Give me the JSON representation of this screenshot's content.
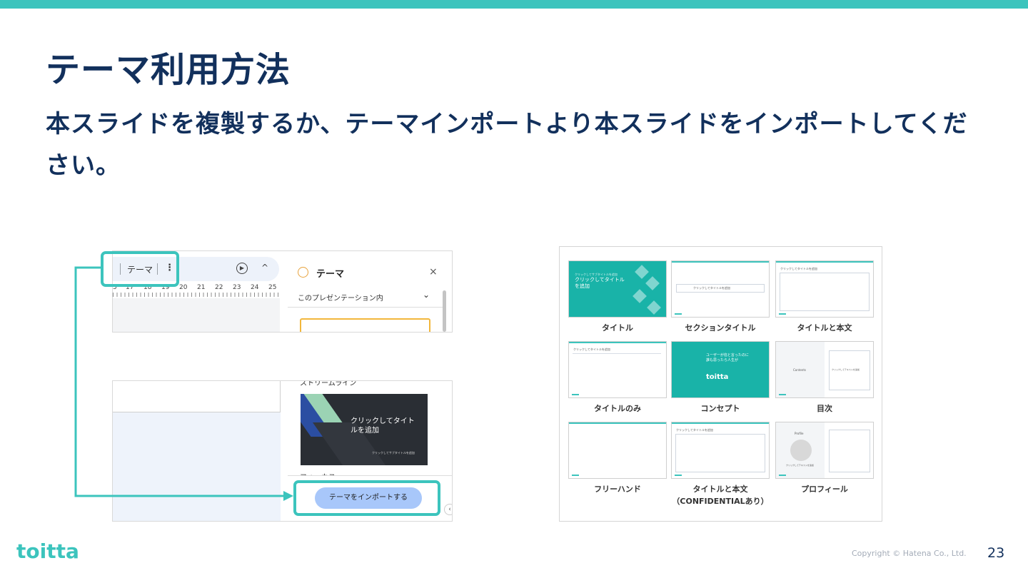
{
  "colors": {
    "accent": "#3cc4bd",
    "title": "#12305c",
    "button": "#a8c7fa",
    "highlight_yellow": "#f2b73c"
  },
  "title": "テーマ利用方法",
  "subtitle": "本スライドを複製するか、テーマインポートより本スライドをインポートしてください。",
  "editor": {
    "toolbar_theme_label": "テーマ",
    "more_icon": "⋮",
    "play_icon": "▶",
    "caret_icon": "^",
    "ruler": [
      "5",
      "17",
      "18",
      "19",
      "20",
      "21",
      "22",
      "23",
      "24",
      "25"
    ],
    "side_title": "テーマ",
    "close_icon": "×",
    "dropdown": "このプレゼンテーション内",
    "dropdown_icon": "⌄",
    "stream_label": "ストリームライン",
    "thumb_title": "クリックしてタイトルを追加",
    "thumb_subtitle": "クリックしてサブタイトルを追加",
    "focus_label": "フォーカス",
    "import_button": "テーマをインポートする",
    "side_arrow_icon": "‹"
  },
  "layouts": [
    {
      "label": "タイトル",
      "thumb_text": "クリックしてタイトルを追加",
      "thumb_sub": "クリックしてサブタイトルを追加"
    },
    {
      "label": "セクションタイトル",
      "thumb_text": "クリックしてタイトルを追加"
    },
    {
      "label": "タイトルと本文",
      "thumb_text": "クリックしてタイトルを追加"
    },
    {
      "label": "タイトルのみ",
      "thumb_text": "クリックしてタイトルを追加"
    },
    {
      "label": "コンセプト",
      "thumb_text": "ユーザーが信と言ったのに誰も思ったら人生が",
      "thumb_logo": "toitta"
    },
    {
      "label": "目次",
      "thumb_text": "Contents",
      "thumb_sub": "クリックしてテキストを追加"
    },
    {
      "label": "フリーハンド"
    },
    {
      "label": "タイトルと本文\n（CONFIDENTIALあり）",
      "thumb_text": "クリックしてタイトルを追加"
    },
    {
      "label": "プロフィール",
      "thumb_text": "Profile",
      "thumb_sub": "クリックしてテキストを追加"
    }
  ],
  "footer": {
    "logo": "toitta",
    "copyright": "Copyright © Hatena Co., Ltd.",
    "page_number": "23"
  }
}
